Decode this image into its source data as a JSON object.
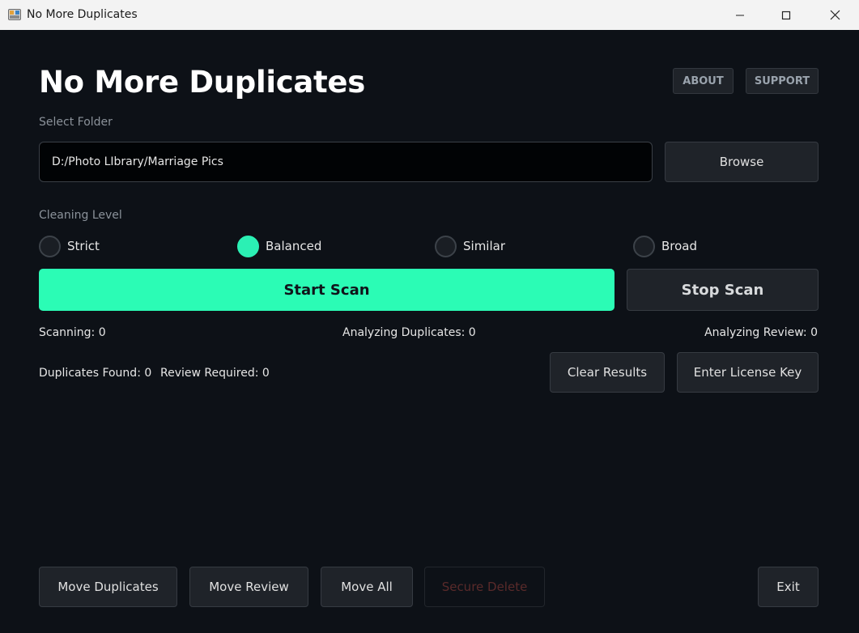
{
  "window": {
    "title": "No More Duplicates",
    "minimize_glyph": "—",
    "maximize_glyph": "☐",
    "close_glyph": "✕"
  },
  "header": {
    "title": "No More Duplicates",
    "about_label": "ABOUT",
    "support_label": "SUPPORT"
  },
  "folder": {
    "label": "Select Folder",
    "value": "D:/Photo LIbrary/Marriage Pics",
    "browse_label": "Browse"
  },
  "cleaning": {
    "label": "Cleaning Level",
    "options": [
      {
        "label": "Strict",
        "checked": false
      },
      {
        "label": "Balanced",
        "checked": true
      },
      {
        "label": "Similar",
        "checked": false
      },
      {
        "label": "Broad",
        "checked": false
      }
    ]
  },
  "scan": {
    "start_label": "Start Scan",
    "stop_label": "Stop Scan"
  },
  "stats": {
    "scanning": "Scanning: 0",
    "analyzing_duplicates": "Analyzing Duplicates: 0",
    "analyzing_review": "Analyzing Review: 0",
    "duplicates_found": "Duplicates Found: 0",
    "review_required": "Review Required: 0"
  },
  "actions": {
    "clear_results": "Clear Results",
    "enter_license": "Enter License Key",
    "move_duplicates": "Move Duplicates",
    "move_review": "Move Review",
    "move_all": "Move All",
    "secure_delete": "Secure Delete",
    "exit": "Exit"
  },
  "colors": {
    "accent": "#2bfcb5",
    "background": "#0d1117",
    "button": "#1f2329",
    "disabled_text": "#5a2a2a"
  }
}
